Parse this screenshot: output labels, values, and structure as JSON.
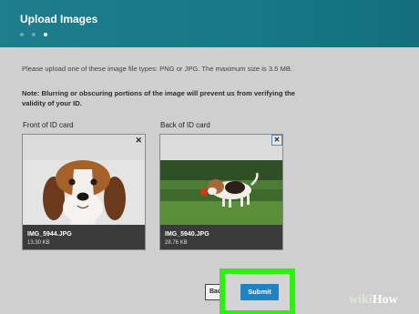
{
  "header": {
    "title": "Upload Images",
    "steps": [
      {
        "active": false
      },
      {
        "active": false
      },
      {
        "active": true
      }
    ]
  },
  "instructions": {
    "file_types": "Please upload one of these image file types: PNG or JPG. The maximum size is 3.5 MB.",
    "note": "Note: Blurring or obscuring portions of the image will prevent us from verifying the validity of your ID."
  },
  "cards": [
    {
      "label": "Front of ID card",
      "filename": "IMG_5944.JPG",
      "filesize": "13.30 KB",
      "close": "✕",
      "image": "beagle-portrait"
    },
    {
      "label": "Back of ID card",
      "filename": "IMG_5940.JPG",
      "filesize": "28.76 KB",
      "close": "✕",
      "image": "beagle-on-grass"
    }
  ],
  "buttons": {
    "back": "Bac",
    "submit": "Submit"
  },
  "watermark": {
    "wiki": "wiki",
    "how": "How"
  },
  "colors": {
    "header": "#177887",
    "submit": "#1f82c1",
    "highlight": "#2cf00e"
  }
}
